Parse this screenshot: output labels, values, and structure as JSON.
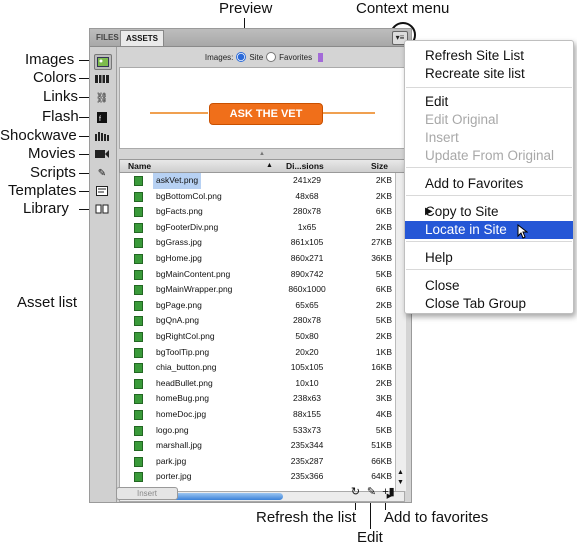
{
  "callouts": {
    "preview": "Preview",
    "context_menu": "Context menu",
    "images": "Images",
    "colors": "Colors",
    "links": "Links",
    "flash": "Flash",
    "shockwave": "Shockwave",
    "movies": "Movies",
    "scripts": "Scripts",
    "templates": "Templates",
    "library": "Library",
    "asset_list": "Asset list",
    "refresh": "Refresh the list",
    "edit": "Edit",
    "add_favorites": "Add to favorites"
  },
  "panel": {
    "tabs": [
      "FILES",
      "ASSETS"
    ],
    "filter_label": "Images:",
    "filter_site": "Site",
    "filter_favorites": "Favorites",
    "preview_button": "ASK THE VET",
    "columns": {
      "name": "Name",
      "dims": "Di...sions",
      "size": "Size"
    },
    "insert_label": "Insert"
  },
  "files": [
    {
      "name": "askVet.png",
      "dims": "241x29",
      "size": "2KB"
    },
    {
      "name": "bgBottomCol.png",
      "dims": "48x68",
      "size": "2KB"
    },
    {
      "name": "bgFacts.png",
      "dims": "280x78",
      "size": "6KB"
    },
    {
      "name": "bgFooterDiv.png",
      "dims": "1x65",
      "size": "2KB"
    },
    {
      "name": "bgGrass.jpg",
      "dims": "861x105",
      "size": "27KB"
    },
    {
      "name": "bgHome.jpg",
      "dims": "860x271",
      "size": "36KB"
    },
    {
      "name": "bgMainContent.png",
      "dims": "890x742",
      "size": "5KB"
    },
    {
      "name": "bgMainWrapper.png",
      "dims": "860x1000",
      "size": "6KB"
    },
    {
      "name": "bgPage.png",
      "dims": "65x65",
      "size": "2KB"
    },
    {
      "name": "bgQnA.png",
      "dims": "280x78",
      "size": "5KB"
    },
    {
      "name": "bgRightCol.png",
      "dims": "50x80",
      "size": "2KB"
    },
    {
      "name": "bgToolTip.png",
      "dims": "20x20",
      "size": "1KB"
    },
    {
      "name": "chia_button.png",
      "dims": "105x105",
      "size": "16KB"
    },
    {
      "name": "headBullet.png",
      "dims": "10x10",
      "size": "2KB"
    },
    {
      "name": "homeBug.png",
      "dims": "238x63",
      "size": "3KB"
    },
    {
      "name": "homeDoc.jpg",
      "dims": "88x155",
      "size": "4KB"
    },
    {
      "name": "logo.png",
      "dims": "533x73",
      "size": "5KB"
    },
    {
      "name": "marshall.jpg",
      "dims": "235x344",
      "size": "51KB"
    },
    {
      "name": "park.jpg",
      "dims": "235x287",
      "size": "66KB"
    },
    {
      "name": "porter.jpg",
      "dims": "235x366",
      "size": "64KB"
    }
  ],
  "menu": [
    {
      "label": "Refresh Site List",
      "state": "normal"
    },
    {
      "label": "Recreate site list",
      "state": "normal"
    },
    {
      "label": "Edit",
      "state": "normal"
    },
    {
      "label": "Edit Original",
      "state": "disabled"
    },
    {
      "label": "Insert",
      "state": "disabled"
    },
    {
      "label": "Update From Original",
      "state": "disabled"
    },
    {
      "label": "Add to Favorites",
      "state": "normal"
    },
    {
      "label": "Copy to Site",
      "state": "normal"
    },
    {
      "label": "Locate in Site",
      "state": "highlighted"
    },
    {
      "label": "Help",
      "state": "normal"
    },
    {
      "label": "Close",
      "state": "normal"
    },
    {
      "label": "Close Tab Group",
      "state": "normal"
    }
  ],
  "colors": {
    "highlight": "#2557d6",
    "preview_button": "#f06f1a",
    "selection": "#b7d1f3"
  }
}
